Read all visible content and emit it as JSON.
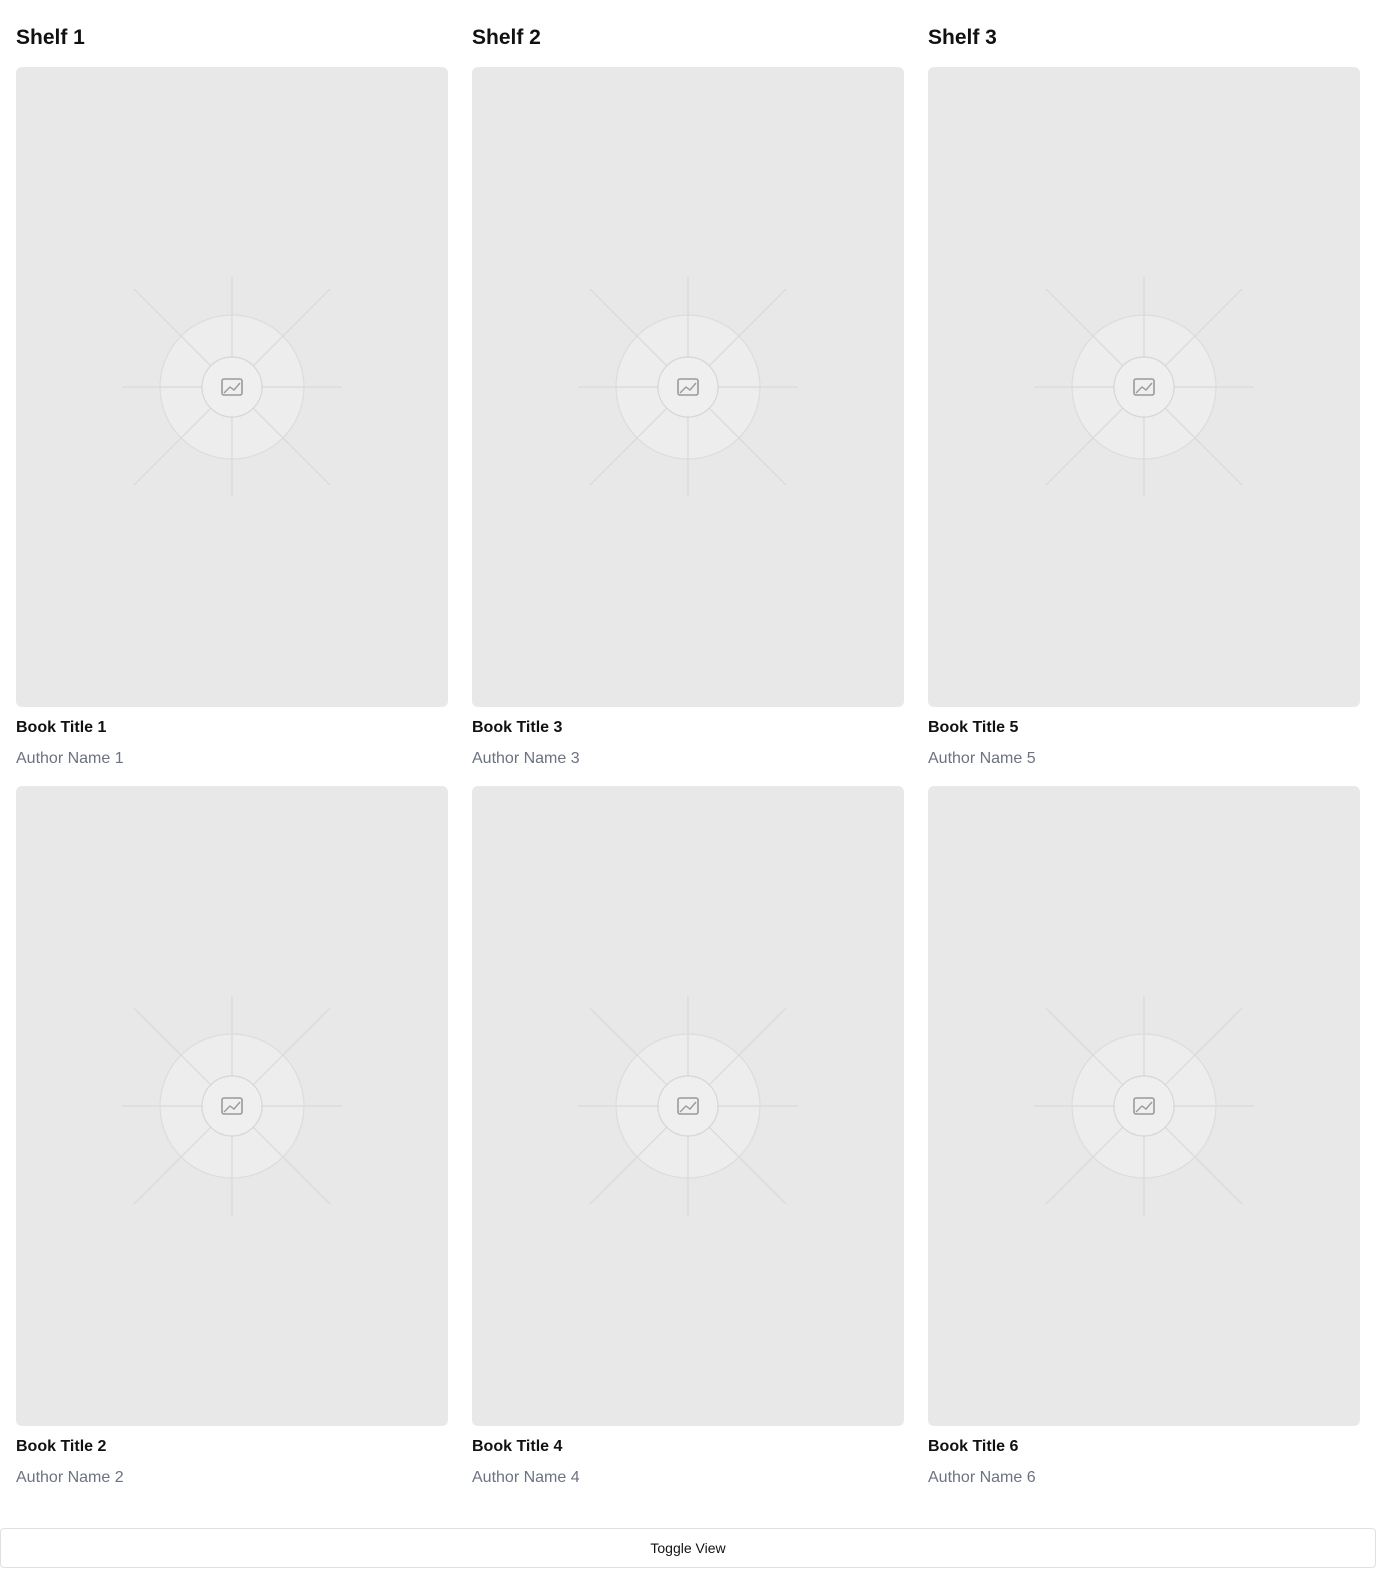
{
  "shelves": [
    {
      "title": "Shelf 1",
      "books": [
        {
          "title": "Book Title 1",
          "author": "Author Name 1"
        },
        {
          "title": "Book Title 2",
          "author": "Author Name 2"
        }
      ]
    },
    {
      "title": "Shelf 2",
      "books": [
        {
          "title": "Book Title 3",
          "author": "Author Name 3"
        },
        {
          "title": "Book Title 4",
          "author": "Author Name 4"
        }
      ]
    },
    {
      "title": "Shelf 3",
      "books": [
        {
          "title": "Book Title 5",
          "author": "Author Name 5"
        },
        {
          "title": "Book Title 6",
          "author": "Author Name 6"
        }
      ]
    }
  ],
  "cover_placeholder_icon": "image-placeholder-icon",
  "toggle_button": {
    "label": "Toggle View"
  },
  "colors": {
    "cover_background": "#e8e8e8",
    "author_text": "#6b7280",
    "title_text": "#111111"
  }
}
